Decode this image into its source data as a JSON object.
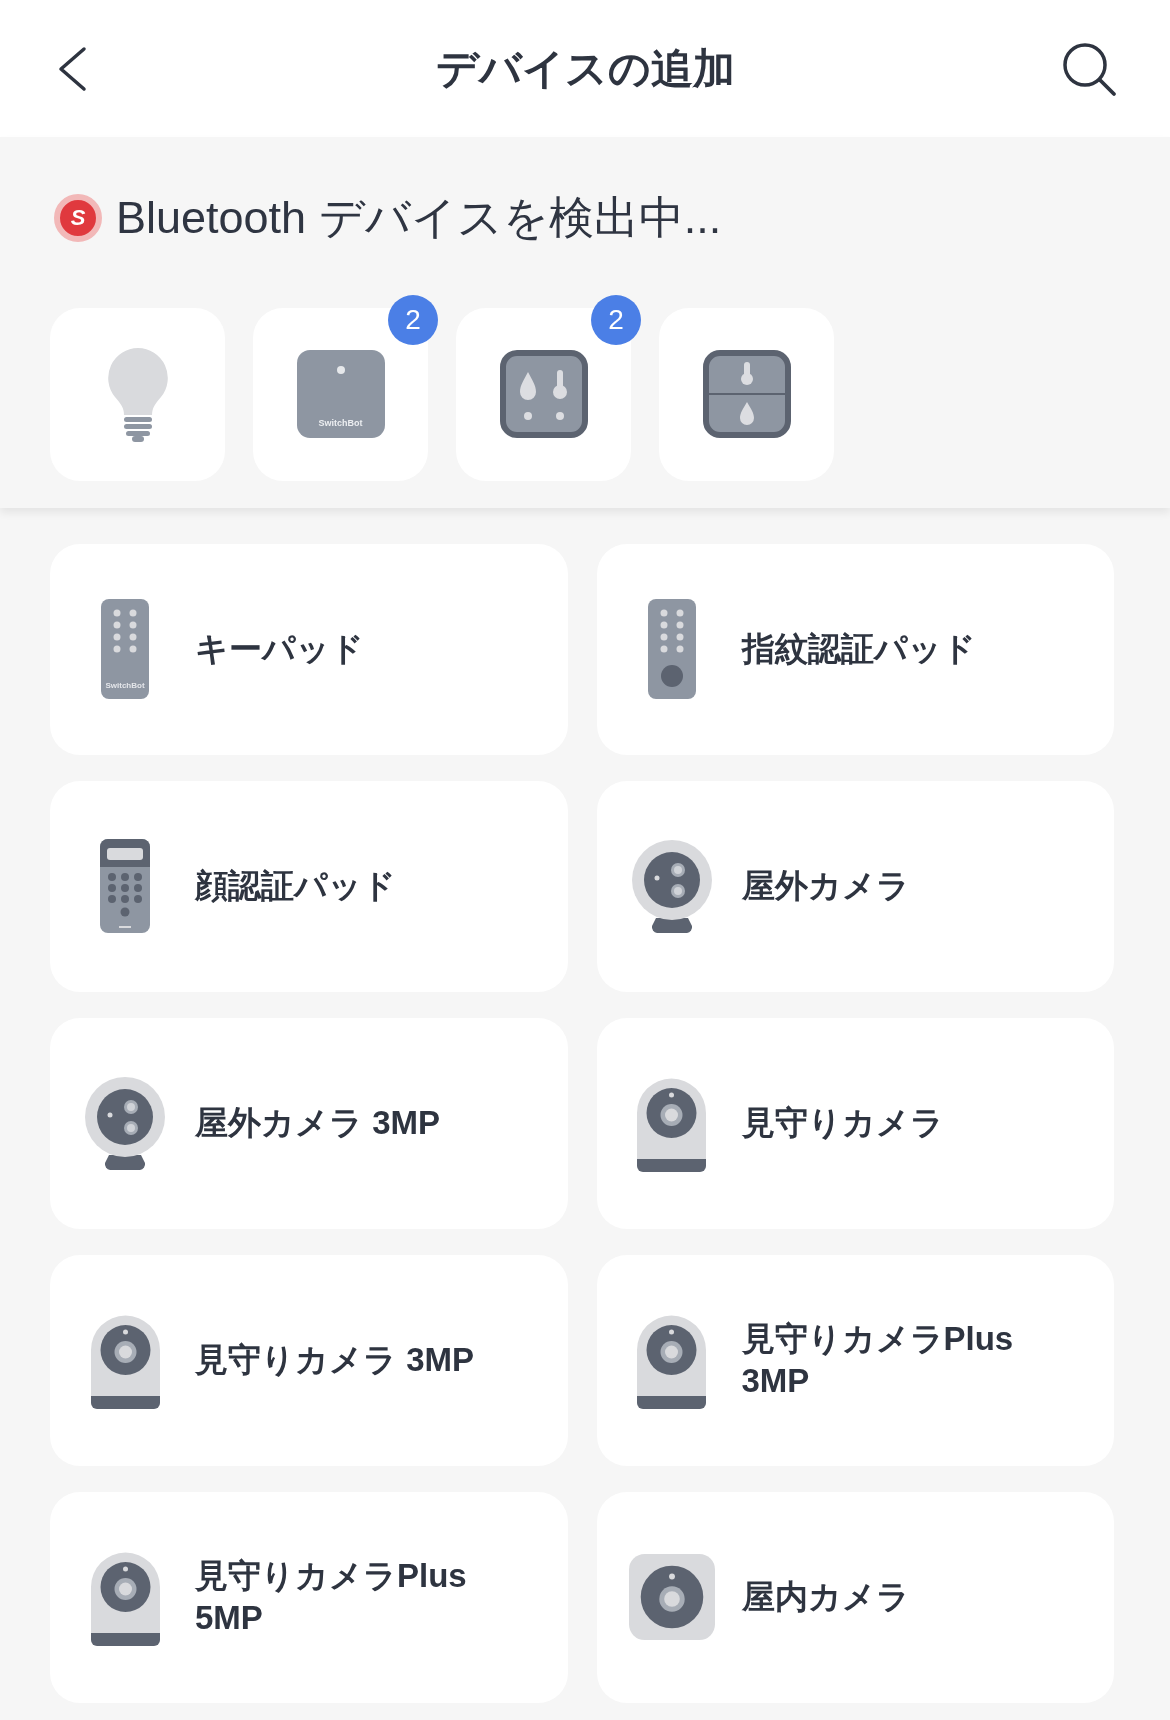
{
  "header": {
    "title": "デバイスの追加"
  },
  "scan": {
    "logo_letter": "S",
    "label": "Bluetooth デバイスを検出中..."
  },
  "found_devices": [
    {
      "kind": "bulb"
    },
    {
      "kind": "hub",
      "logo_text": "SwitchBot",
      "badge": "2"
    },
    {
      "kind": "meter",
      "badge": "2"
    },
    {
      "kind": "meter_split"
    }
  ],
  "devices": [
    {
      "kind": "keypad",
      "name": "キーパッド",
      "logo_text": "SwitchBot"
    },
    {
      "kind": "fingerprint_pad",
      "name": "指紋認証パッド"
    },
    {
      "kind": "face_pad",
      "name": "顔認証パッド"
    },
    {
      "kind": "outdoor_camera",
      "name": "屋外カメラ"
    },
    {
      "kind": "outdoor_camera",
      "name": "屋外カメラ 3MP"
    },
    {
      "kind": "pan_camera",
      "name": "見守りカメラ"
    },
    {
      "kind": "pan_camera",
      "name": "見守りカメラ 3MP"
    },
    {
      "kind": "pan_camera",
      "name": "見守りカメラPlus 3MP"
    },
    {
      "kind": "pan_camera",
      "name": "見守りカメラPlus 5MP"
    },
    {
      "kind": "indoor_camera",
      "name": "屋内カメラ"
    }
  ]
}
